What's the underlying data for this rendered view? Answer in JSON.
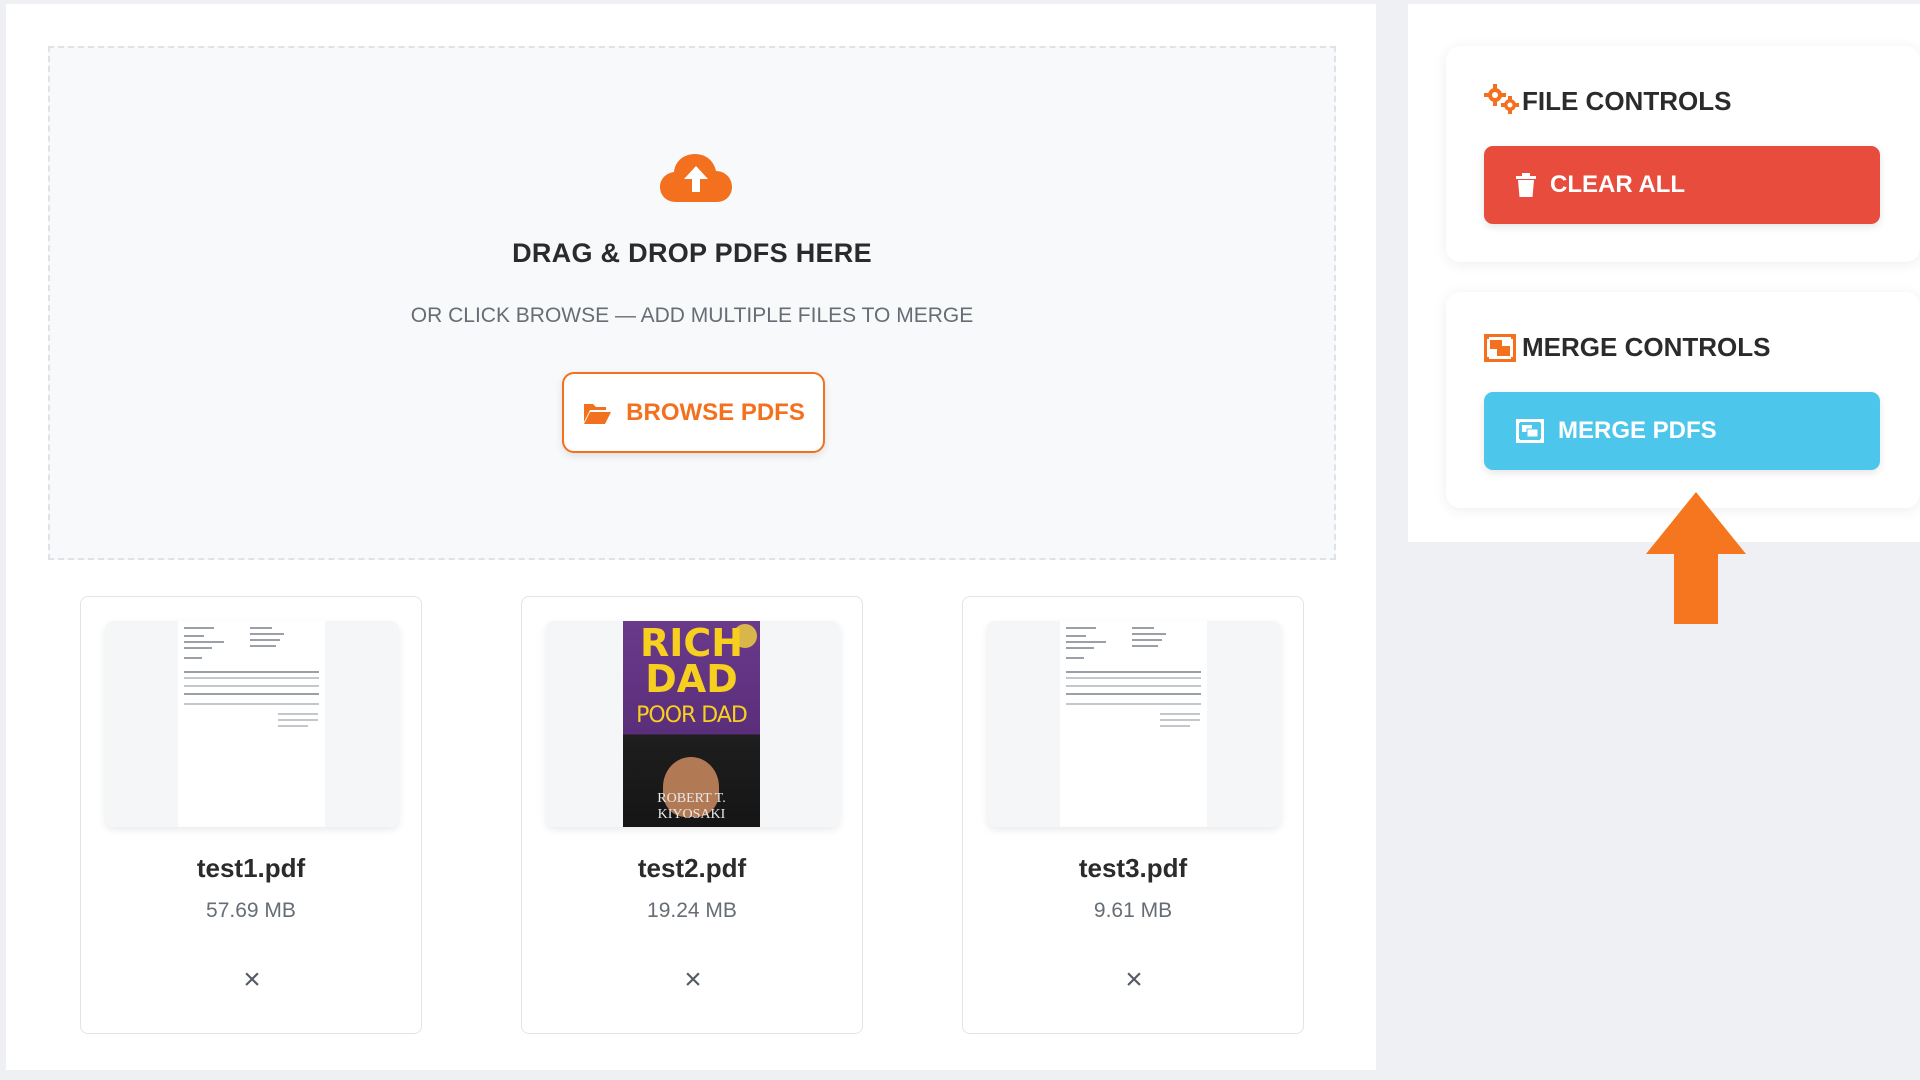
{
  "dropzone": {
    "title": "DRAG & DROP PDFS HERE",
    "subtitle": "OR CLICK BROWSE — ADD MULTIPLE FILES TO MERGE",
    "browse_label": "BROWSE PDFS",
    "upload_icon": "cloud-upload-icon",
    "browse_icon": "folder-open-icon"
  },
  "files": [
    {
      "name": "test1.pdf",
      "size": "57.69 MB",
      "thumbnail": "document-page",
      "remove_glyph": "×"
    },
    {
      "name": "test2.pdf",
      "size": "19.24 MB",
      "thumbnail": "book-cover",
      "remove_glyph": "×",
      "cover": {
        "line1": "RICH",
        "line2": "DAD",
        "line3": "POOR DAD",
        "author": "ROBERT T. KIYOSAKI"
      }
    },
    {
      "name": "test3.pdf",
      "size": "9.61 MB",
      "thumbnail": "document-page",
      "remove_glyph": "×"
    }
  ],
  "sidebar": {
    "file_controls": {
      "title": "FILE CONTROLS",
      "icon": "gears-icon",
      "clear_label": "CLEAR ALL",
      "clear_icon": "trash-icon"
    },
    "merge_controls": {
      "title": "MERGE CONTROLS",
      "icon": "object-group-icon",
      "merge_label": "MERGE PDFS",
      "merge_icon": "object-group-icon"
    }
  },
  "colors": {
    "accent_orange": "#f3701f",
    "danger_red": "#e74c3c",
    "merge_blue": "#4cc6ea",
    "annotation_arrow": "#f5761f"
  }
}
